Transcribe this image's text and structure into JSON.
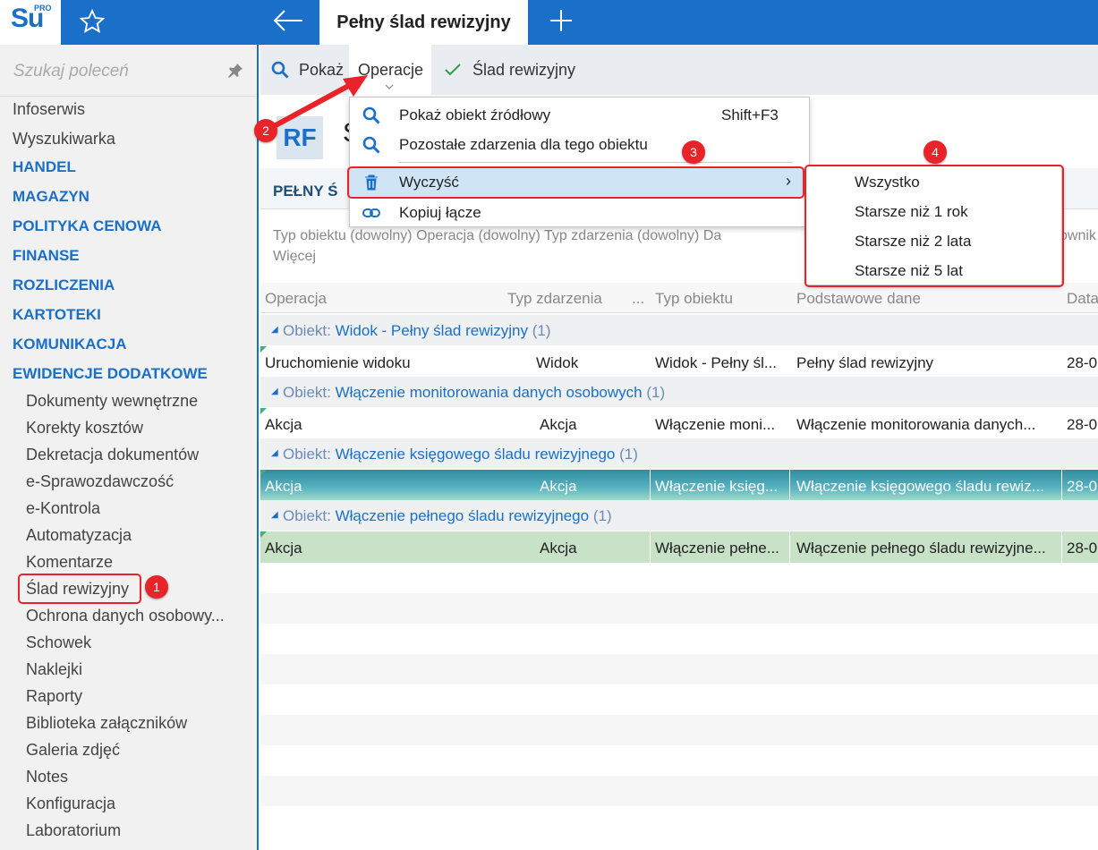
{
  "app": {
    "logo_text": "Su",
    "logo_badge": "PRO",
    "tab_title": "Pełny ślad rewizyjny"
  },
  "sidebar": {
    "search_placeholder": "Szukaj poleceń",
    "top_items": [
      "Infoserwis",
      "Wyszukiwarka"
    ],
    "sections": [
      "HANDEL",
      "MAGAZYN",
      "POLITYKA CENOWA",
      "FINANSE",
      "ROZLICZENIA",
      "KARTOTEKI",
      "KOMUNIKACJA",
      "EWIDENCJE DODATKOWE"
    ],
    "sub_items": [
      "Dokumenty wewnętrzne",
      "Korekty kosztów",
      "Dekretacja dokumentów",
      "e-Sprawozdawczość",
      "e-Kontrola",
      "Automatyzacja",
      "Komentarze",
      "Ślad rewizyjny",
      "Ochrona danych osobowy...",
      "Schowek",
      "Naklejki",
      "Raporty",
      "Biblioteka załączników",
      "Galeria zdjęć",
      "Notes",
      "Konfiguracja",
      "Laboratorium"
    ]
  },
  "toolbar": {
    "show_label": "Pokaż",
    "operations_label": "Operacje",
    "audit_label": "Ślad rewizyjny"
  },
  "header": {
    "rf": "RF",
    "s": "Ś",
    "band_title": "PEŁNY Ś",
    "filters_line1": "Typ obiektu (dowolny)   Operacja (dowolny)   Typ zdarzenia (dowolny)   Da",
    "filters_tail": "ownik",
    "filters_line2": "Więcej"
  },
  "grid": {
    "columns": [
      "Operacja",
      "Typ zdarzenia",
      "...",
      "Typ obiektu",
      "Podstawowe dane",
      "Data"
    ],
    "groups": [
      {
        "prefix": "Obiekt:",
        "name": "Widok - Pełny ślad rewizyjny",
        "count": "(1)",
        "row": [
          "Uruchomienie widoku",
          "Widok",
          "Widok - Pełny śl...",
          "Pełny ślad rewizyjny",
          "28-0"
        ]
      },
      {
        "prefix": "Obiekt:",
        "name": "Włączenie monitorowania danych osobowych",
        "count": "(1)",
        "row": [
          "Akcja",
          "Akcja",
          "Włączenie moni...",
          "Włączenie monitorowania danych...",
          "28-0"
        ]
      },
      {
        "prefix": "Obiekt:",
        "name": "Włączenie księgowego śladu rewizyjnego",
        "count": "(1)",
        "row": [
          "Akcja",
          "Akcja",
          "Włączenie księg...",
          "Włączenie księgowego śladu rewiz...",
          "28-0"
        ]
      },
      {
        "prefix": "Obiekt:",
        "name": "Włączenie pełnego śladu rewizyjnego",
        "count": "(1)",
        "row": [
          "Akcja",
          "Akcja",
          "Włączenie pełne...",
          "Włączenie pełnego śladu rewizyjne...",
          "28-0"
        ]
      }
    ]
  },
  "menu": {
    "items": [
      {
        "label": "Pokaż obiekt źródłowy",
        "shortcut": "Shift+F3",
        "icon": "search-icon"
      },
      {
        "label": "Pozostałe zdarzenia dla tego obiektu",
        "shortcut": "",
        "icon": "search-icon"
      },
      {
        "label": "Wyczyść",
        "shortcut": "›",
        "icon": "trash-icon"
      },
      {
        "label": "Kopiuj łącze",
        "shortcut": "",
        "icon": "link-icon"
      }
    ]
  },
  "submenu": {
    "items": [
      "Wszystko",
      "Starsze niż 1 rok",
      "Starsze niż 2 lata",
      "Starsze niż 5 lat"
    ]
  },
  "markers": [
    "1",
    "2",
    "3",
    "4"
  ],
  "colors": {
    "accent": "#1a70c8",
    "annotation": "#e8232a",
    "selection": "#cfe4f5"
  }
}
